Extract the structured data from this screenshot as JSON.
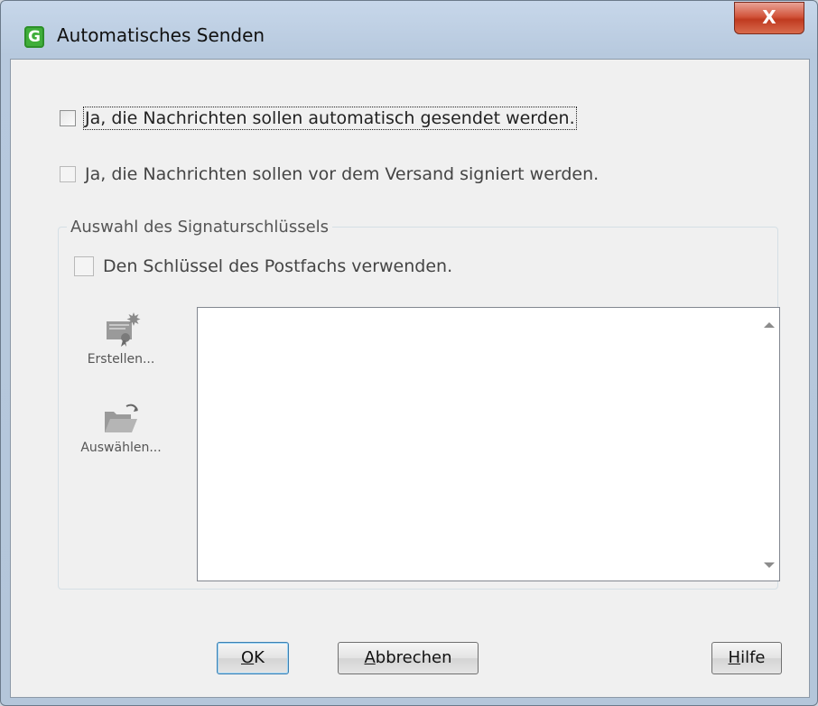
{
  "window": {
    "title": "Automatisches Senden",
    "app_icon_letter": "G",
    "close_label": "X"
  },
  "checkboxes": {
    "auto_send": {
      "label": "Ja, die Nachrichten sollen automatisch gesendet werden.",
      "checked": false
    },
    "sign": {
      "label": "Ja, die Nachrichten sollen vor dem Versand signiert werden.",
      "checked": false,
      "enabled": false
    }
  },
  "signature_group": {
    "title": "Auswahl des Signaturschlüssels",
    "use_mailbox_key": {
      "label": "Den Schlüssel des Postfachs verwenden.",
      "checked": false
    },
    "create_label": "Erstellen...",
    "select_label": "Auswählen..."
  },
  "buttons": {
    "ok": {
      "mnemonic": "O",
      "rest": "K"
    },
    "cancel": {
      "mnemonic": "A",
      "rest": "bbrechen"
    },
    "help": {
      "mnemonic": "H",
      "rest": "ilfe"
    }
  }
}
